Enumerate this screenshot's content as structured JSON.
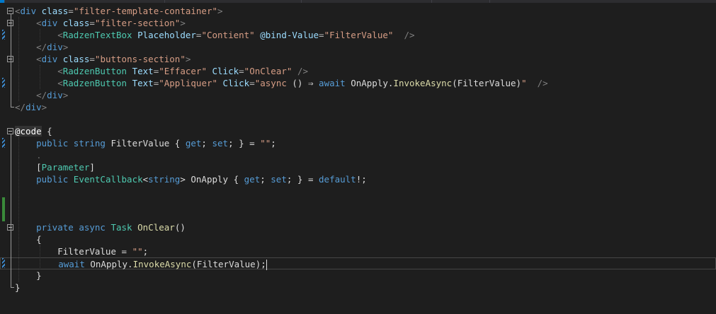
{
  "editor": {
    "lines": [
      {
        "parts": [
          [
            "t-tag",
            "<"
          ],
          [
            "t-el",
            "div "
          ],
          [
            "t-attr",
            "class"
          ],
          [
            "t-eq",
            "="
          ],
          [
            "t-str",
            "\"filter-template-container\""
          ],
          [
            "t-tag",
            ">"
          ]
        ]
      },
      {
        "parts": [
          [
            "t-id",
            "    "
          ],
          [
            "t-tag",
            "<"
          ],
          [
            "t-el",
            "div "
          ],
          [
            "t-attr",
            "class"
          ],
          [
            "t-eq",
            "="
          ],
          [
            "t-str",
            "\"filter-section\""
          ],
          [
            "t-tag",
            ">"
          ]
        ]
      },
      {
        "parts": [
          [
            "t-id",
            "        "
          ],
          [
            "t-tag",
            "<"
          ],
          [
            "t-comp",
            "RadzenTextBox "
          ],
          [
            "t-attr",
            "Placeholder"
          ],
          [
            "t-eq",
            "="
          ],
          [
            "t-str",
            "\"Contient\" "
          ],
          [
            "t-attr",
            "@bind-Value"
          ],
          [
            "t-eq",
            "="
          ],
          [
            "t-str",
            "\"FilterValue\" "
          ],
          [
            "t-tag",
            " />"
          ]
        ]
      },
      {
        "parts": [
          [
            "t-id",
            "    "
          ],
          [
            "t-tag",
            "</"
          ],
          [
            "t-el",
            "div"
          ],
          [
            "t-tag",
            ">"
          ]
        ]
      },
      {
        "parts": [
          [
            "t-id",
            "    "
          ],
          [
            "t-tag",
            "<"
          ],
          [
            "t-el",
            "div "
          ],
          [
            "t-attr",
            "class"
          ],
          [
            "t-eq",
            "="
          ],
          [
            "t-str",
            "\"buttons-section\""
          ],
          [
            "t-tag",
            ">"
          ]
        ]
      },
      {
        "parts": [
          [
            "t-id",
            "        "
          ],
          [
            "t-tag",
            "<"
          ],
          [
            "t-comp",
            "RadzenButton "
          ],
          [
            "t-attr",
            "Text"
          ],
          [
            "t-eq",
            "="
          ],
          [
            "t-str",
            "\"Effacer\" "
          ],
          [
            "t-attr",
            "Click"
          ],
          [
            "t-eq",
            "="
          ],
          [
            "t-str",
            "\"OnClear\" "
          ],
          [
            "t-tag",
            "/>"
          ]
        ]
      },
      {
        "parts": [
          [
            "t-id",
            "        "
          ],
          [
            "t-tag",
            "<"
          ],
          [
            "t-comp",
            "RadzenButton "
          ],
          [
            "t-attr",
            "Text"
          ],
          [
            "t-eq",
            "="
          ],
          [
            "t-str",
            "\"Appliquer\" "
          ],
          [
            "t-attr",
            "Click"
          ],
          [
            "t-eq",
            "="
          ],
          [
            "t-str",
            "\"async "
          ],
          [
            "t-id",
            "() ⇒ "
          ],
          [
            "t-kw",
            "await "
          ],
          [
            "t-id",
            "OnApply."
          ],
          [
            "t-mth",
            "InvokeAsync"
          ],
          [
            "t-id",
            "(FilterValue)"
          ],
          [
            "t-str",
            "\" "
          ],
          [
            "t-tag",
            " />"
          ]
        ]
      },
      {
        "parts": [
          [
            "t-id",
            "    "
          ],
          [
            "t-tag",
            "</"
          ],
          [
            "t-el",
            "div"
          ],
          [
            "t-tag",
            ">"
          ]
        ]
      },
      {
        "parts": [
          [
            "t-tag",
            "</"
          ],
          [
            "t-el",
            "div"
          ],
          [
            "t-tag",
            ">"
          ]
        ]
      },
      {
        "parts": []
      },
      {
        "parts": [
          [
            "t-dir",
            "@code"
          ],
          [
            "t-id",
            " {"
          ]
        ]
      },
      {
        "parts": [
          [
            "t-id",
            "    "
          ],
          [
            "t-kw",
            "public "
          ],
          [
            "t-kw",
            "string "
          ],
          [
            "t-id",
            "FilterValue { "
          ],
          [
            "t-kw",
            "get"
          ],
          [
            "t-id",
            "; "
          ],
          [
            "t-kw",
            "set"
          ],
          [
            "t-id",
            "; } = "
          ],
          [
            "t-str",
            "\"\""
          ],
          [
            "t-id",
            ";"
          ]
        ]
      },
      {
        "parts": [
          [
            "t-dim",
            "    ."
          ]
        ]
      },
      {
        "parts": [
          [
            "t-id",
            "    ["
          ],
          [
            "t-type",
            "Parameter"
          ],
          [
            "t-id",
            "]"
          ]
        ]
      },
      {
        "parts": [
          [
            "t-id",
            "    "
          ],
          [
            "t-kw",
            "public "
          ],
          [
            "t-type",
            "EventCallback"
          ],
          [
            "t-id",
            "<"
          ],
          [
            "t-kw",
            "string"
          ],
          [
            "t-id",
            "> OnApply { "
          ],
          [
            "t-kw",
            "get"
          ],
          [
            "t-id",
            "; "
          ],
          [
            "t-kw",
            "set"
          ],
          [
            "t-id",
            "; } = "
          ],
          [
            "t-kw",
            "default"
          ],
          [
            "t-id",
            "!;"
          ]
        ]
      },
      {
        "parts": []
      },
      {
        "parts": []
      },
      {
        "parts": []
      },
      {
        "parts": [
          [
            "t-id",
            "    "
          ],
          [
            "t-kw",
            "private "
          ],
          [
            "t-kw",
            "async "
          ],
          [
            "t-type",
            "Task "
          ],
          [
            "t-mth",
            "OnClear"
          ],
          [
            "t-id",
            "()"
          ]
        ]
      },
      {
        "parts": [
          [
            "t-id",
            "    {"
          ]
        ]
      },
      {
        "parts": [
          [
            "t-id",
            "        FilterValue = "
          ],
          [
            "t-str",
            "\"\""
          ],
          [
            "t-id",
            ";"
          ]
        ]
      },
      {
        "parts": [
          [
            "t-id",
            "        "
          ],
          [
            "t-kw",
            "await "
          ],
          [
            "t-id",
            "OnApply."
          ],
          [
            "t-mth",
            "InvokeAsync"
          ],
          [
            "t-id",
            "(FilterValue);"
          ]
        ],
        "caret": true
      },
      {
        "parts": [
          [
            "t-id",
            "    }"
          ]
        ]
      },
      {
        "parts": [
          [
            "t-id",
            "}"
          ]
        ]
      }
    ]
  },
  "colors": {
    "background": "#1e1e1e",
    "keyword": "#569cd6",
    "type": "#4ec9b0",
    "attribute": "#9cdcfe",
    "string": "#d69d85",
    "method": "#dcdcaa",
    "text": "#dcdcdc",
    "modified_marker": "#3c8cd2",
    "saved_marker": "#3a8a3a"
  },
  "icons": [
    "fold-collapse-icon",
    "change-marker-icon"
  ]
}
